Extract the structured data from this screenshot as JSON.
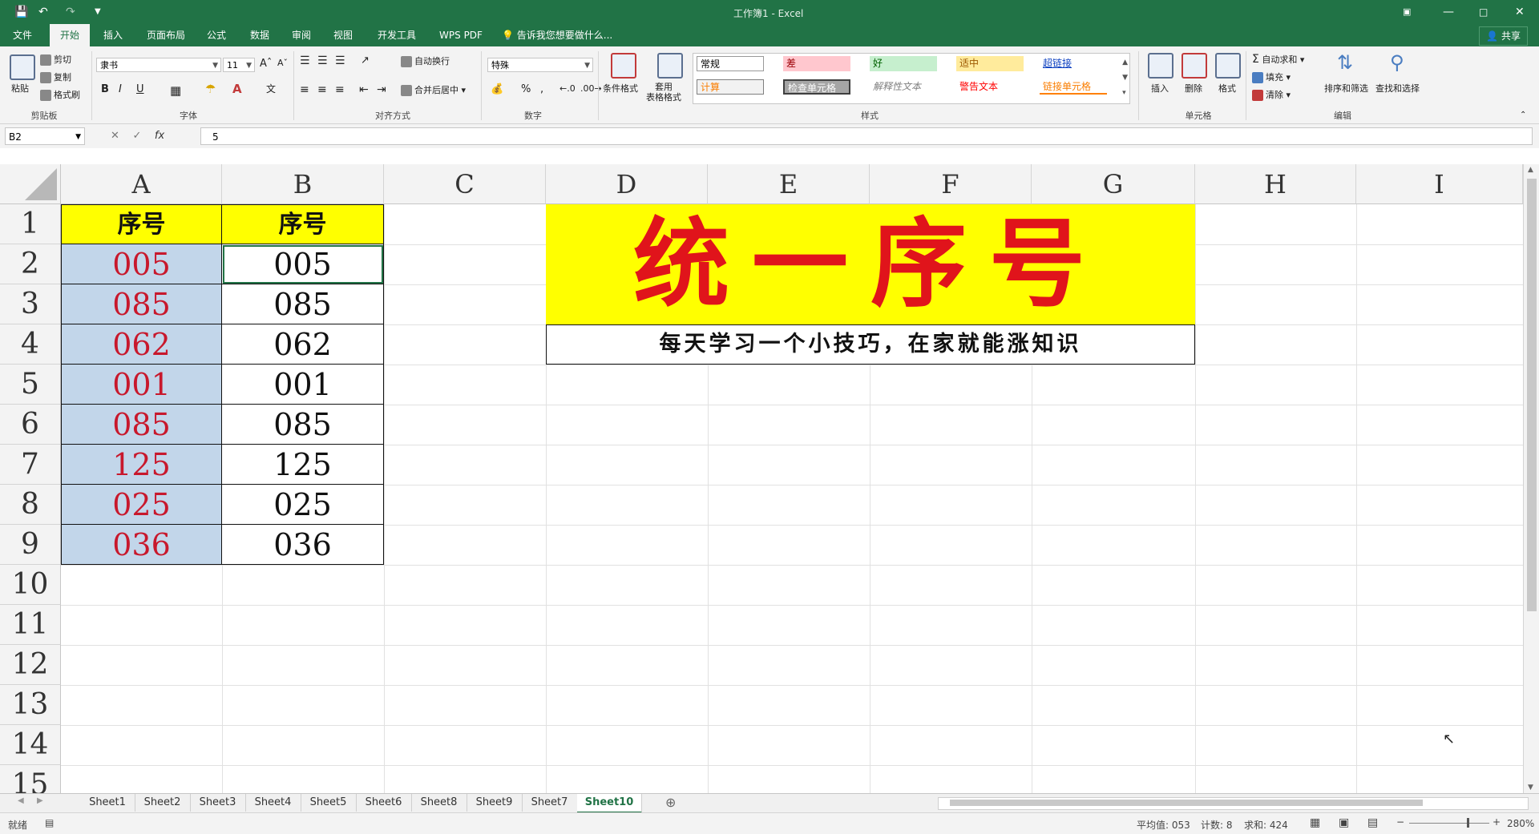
{
  "titlebar": {
    "title": "工作簿1 - Excel",
    "save_icon": "save-icon",
    "undo_icon": "undo-icon",
    "redo_icon": "redo-icon"
  },
  "tabs": [
    "文件",
    "开始",
    "插入",
    "页面布局",
    "公式",
    "数据",
    "审阅",
    "视图",
    "开发工具",
    "WPS PDF"
  ],
  "active_tab": "开始",
  "tell_me": "告诉我您想要做什么...",
  "share": "共享",
  "ribbon": {
    "clipboard": {
      "paste": "粘贴",
      "cut": "剪切",
      "copy": "复制",
      "format_painter": "格式刷",
      "label": "剪贴板"
    },
    "font": {
      "name": "隶书",
      "size": "11",
      "bold": "B",
      "italic": "I",
      "underline": "U",
      "label": "字体"
    },
    "alignment": {
      "wrap": "自动换行",
      "merge": "合并后居中",
      "label": "对齐方式"
    },
    "number": {
      "format": "特殊",
      "percent": "%",
      "comma": ",",
      "label": "数字"
    },
    "styles": {
      "conditional": "条件格式",
      "table": "套用\n表格格式",
      "cells": [
        "常规",
        "差",
        "好",
        "适中",
        "超链接",
        "计算",
        "检查单元格",
        "解释性文本",
        "警告文本",
        "链接单元格"
      ],
      "label": "样式"
    },
    "cells_group": {
      "insert": "插入",
      "delete": "删除",
      "format": "格式",
      "label": "单元格"
    },
    "editing": {
      "autosum": "自动求和",
      "fill": "填充",
      "clear": "清除",
      "sort": "排序和筛选",
      "find": "查找和选择",
      "label": "编辑"
    }
  },
  "formula_bar": {
    "name_box": "B2",
    "fx": "fx",
    "value": "5"
  },
  "grid": {
    "columns": [
      "A",
      "B",
      "C",
      "D",
      "E",
      "F",
      "G",
      "H",
      "I"
    ],
    "rows": [
      "1",
      "2",
      "3",
      "4",
      "5",
      "6",
      "7",
      "8",
      "9",
      "10",
      "11",
      "12",
      "13",
      "14",
      "15"
    ],
    "header_a": "序号",
    "header_b": "序号",
    "col_a": [
      "005",
      "085",
      "062",
      "001",
      "085",
      "125",
      "025",
      "036"
    ],
    "col_b": [
      "005",
      "085",
      "062",
      "001",
      "085",
      "125",
      "025",
      "036"
    ],
    "banner_title": "统一序号",
    "banner_subtitle": "每天学习一个小技巧，在家就能涨知识"
  },
  "sheets": [
    "Sheet1",
    "Sheet2",
    "Sheet3",
    "Sheet4",
    "Sheet5",
    "Sheet6",
    "Sheet8",
    "Sheet9",
    "Sheet7",
    "Sheet10"
  ],
  "active_sheet": "Sheet10",
  "statusbar": {
    "ready": "就绪",
    "average": "平均值: 053",
    "count": "计数: 8",
    "sum": "求和: 424",
    "zoom": "280%"
  },
  "colors": {
    "excel_green": "#217346",
    "header_yellow": "#ffff00",
    "banner_red": "#e0141b",
    "col_a_fill": "#c2d6ea",
    "col_a_text": "#c8182c"
  }
}
